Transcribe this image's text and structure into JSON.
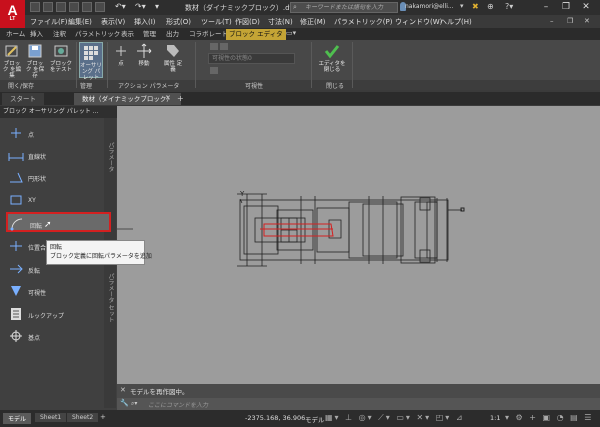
{
  "app": {
    "logo": "A",
    "logo_sub": "LT",
    "title": "数材（ダイナミックブロック）.dwg"
  },
  "search": {
    "placeholder": "キーワードまたは語句を入力"
  },
  "user": {
    "name": "nakamori@elli..."
  },
  "menubar": [
    "ファイル(F)",
    "編集(E)",
    "表示(V)",
    "挿入(I)",
    "形式(O)",
    "ツール(T)",
    "作図(D)",
    "寸法(N)",
    "修正(M)",
    "パラメトリック(P)",
    "ウィンドウ(W)",
    "ヘルプ(H)"
  ],
  "ribbon_tabs": [
    "ホーム",
    "挿入",
    "注釈",
    "パラメトリック",
    "表示",
    "管理",
    "出力",
    "コラボレート",
    "ブロック エディタ"
  ],
  "ribbon": {
    "open_save_buttons": [
      "ブロック を編集",
      "ブロック を保存",
      "ブロック をテスト"
    ],
    "palette_button": "オーサリング パレット",
    "point_button": "点",
    "move_button": "移動",
    "attr_button": "属性 定義",
    "visibility_placeholder": "可視性の状態0",
    "close_button": "エディタを閉じる",
    "panels": [
      "開く/保存",
      "管理",
      "アクション パラメータ",
      "可視性",
      "閉じる"
    ]
  },
  "doc_tabs": [
    "スタート",
    "数材（ダイナミックブロック）"
  ],
  "palette": {
    "title": "ブロック オーサリング パレット ...",
    "items": [
      "点",
      "直線状",
      "円形状",
      "XY",
      "回転",
      "位置合",
      "反転",
      "可視性",
      "ルックアップ",
      "基点"
    ],
    "side_tabs": [
      "パラメータ",
      "パラメータ セット"
    ]
  },
  "tooltip": {
    "title": "回転",
    "desc": "ブロック定義に回転パラメータを追加"
  },
  "command": {
    "history": "モデルを再作図中。",
    "placeholder": "ここにコマンドを入力"
  },
  "status": {
    "tabs": [
      "モデル",
      "Sheet1",
      "Sheet2"
    ],
    "coords": "-2375.168, 36.906",
    "mode": "モデル",
    "scale": "1:1"
  },
  "colors": {
    "accent": "#c4a435",
    "highlight": "#d42020"
  }
}
